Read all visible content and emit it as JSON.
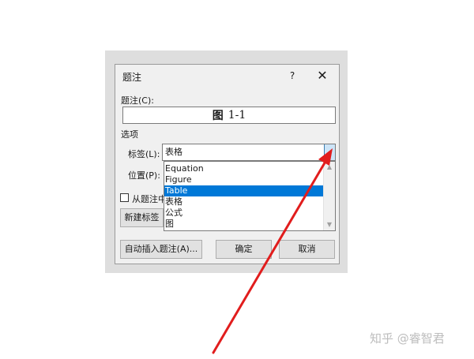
{
  "dialog": {
    "title": "题注",
    "help": "?",
    "close": "✕",
    "caption_label": "题注(C):",
    "caption_prefix": "图",
    "caption_number": "1-1",
    "options_label": "选项",
    "label_label": "标签(L):",
    "label_value": "表格",
    "position_label": "位置(P):",
    "dropdown_items": [
      "Equation",
      "Figure",
      "Table",
      "表格",
      "公式",
      "图"
    ],
    "selected_item": "Table",
    "exclude_label_partial": "从题注中",
    "new_label_partial": "新建标签",
    "autoinsert_button": "自动插入题注(A)...",
    "ok_button": "确定",
    "cancel_button": "取消"
  },
  "watermark": "知乎 @睿智君",
  "colors": {
    "selection": "#0078d7",
    "arrow": "#e11d1d"
  }
}
